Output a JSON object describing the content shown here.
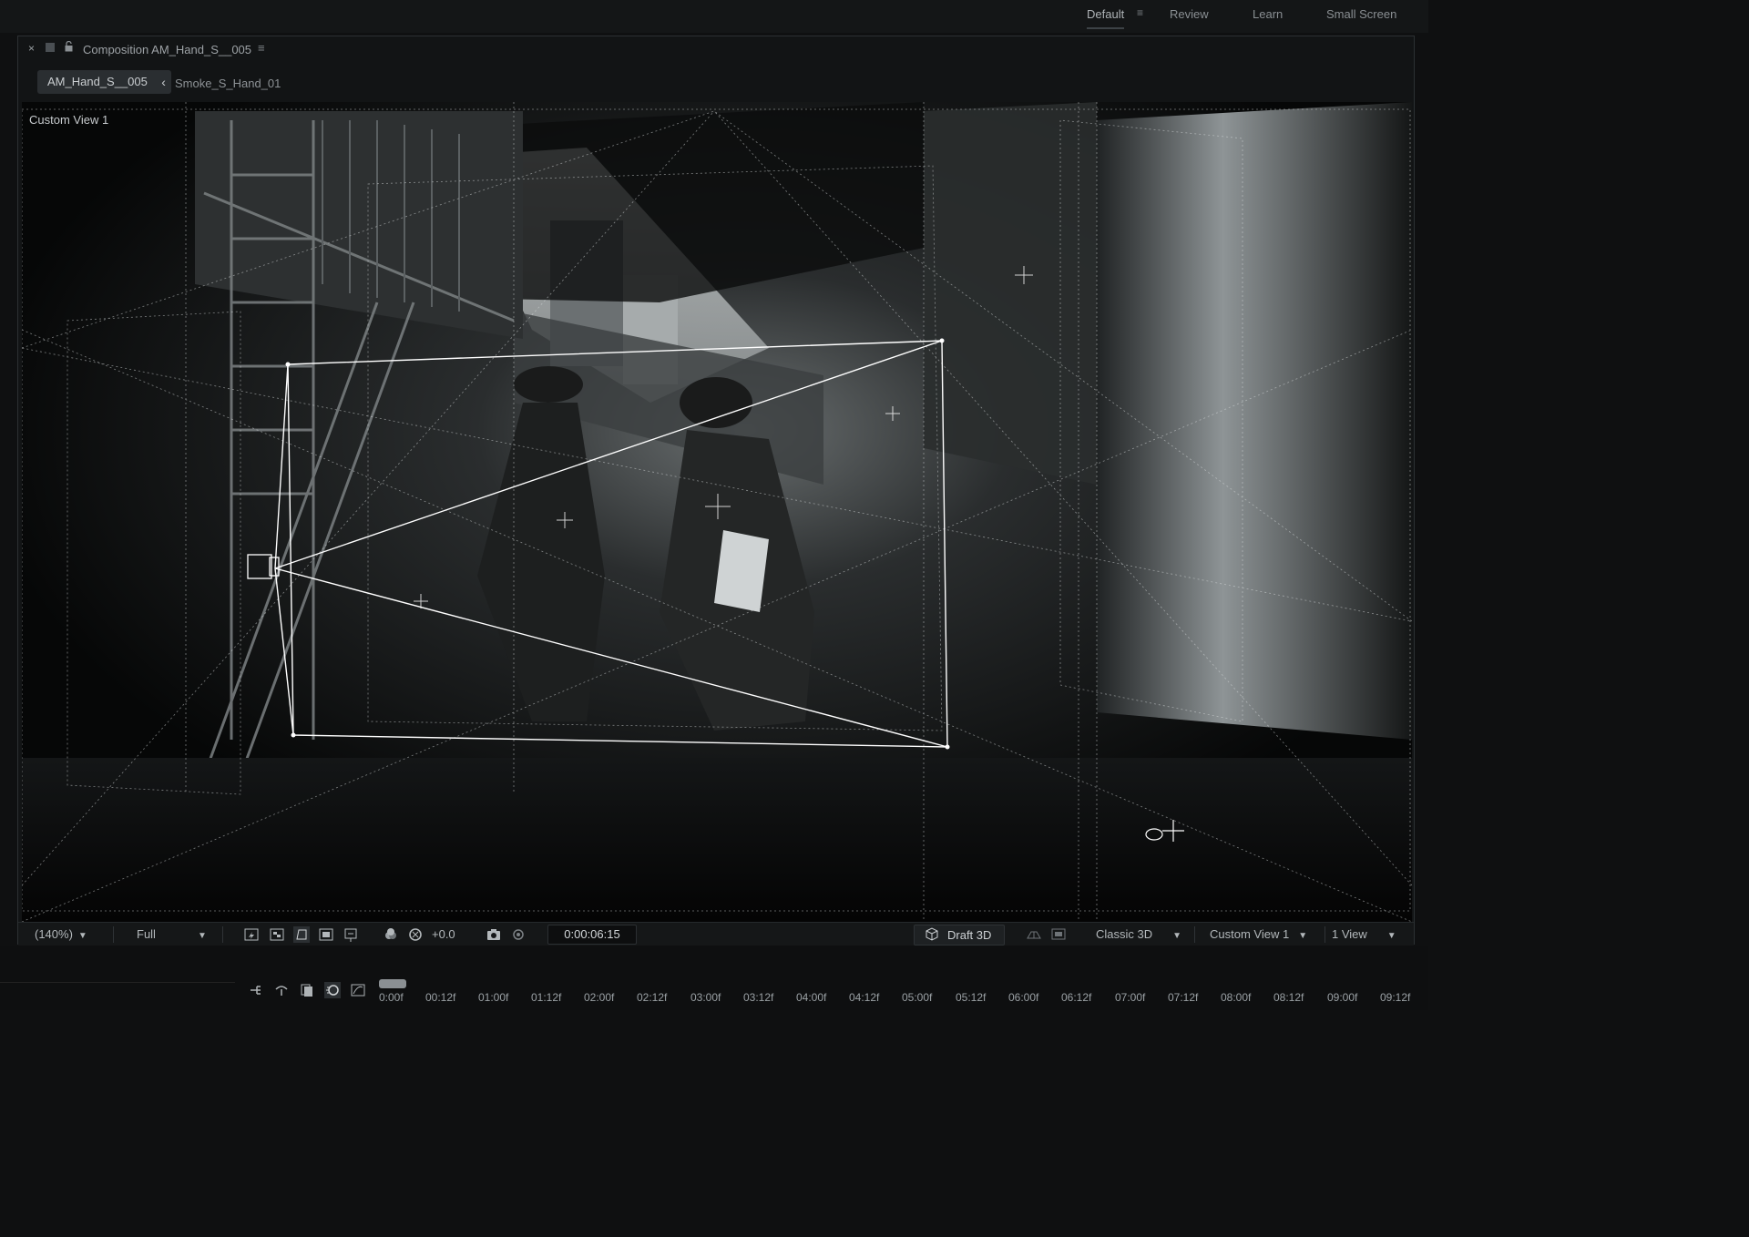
{
  "workspace": {
    "tabs": [
      {
        "label": "Default",
        "active": true
      },
      {
        "label": "Review",
        "active": false
      },
      {
        "label": "Learn",
        "active": false
      },
      {
        "label": "Small Screen",
        "active": false
      }
    ]
  },
  "panel": {
    "title": "Composition AM_Hand_S__005",
    "breadcrumbs": [
      "AM_Hand_S__005",
      "Smoke_S_Hand_01"
    ]
  },
  "viewer": {
    "view_label": "Custom View 1"
  },
  "toolbar": {
    "zoom": "(140%)",
    "resolution": "Full",
    "exposure": "+0.0",
    "timecode": "0:00:06:15",
    "draft_label": "Draft 3D",
    "renderer": "Classic 3D",
    "view": "Custom View 1",
    "layout": "1 View"
  },
  "timeline": {
    "ticks": [
      "0:00f",
      "00:12f",
      "01:00f",
      "01:12f",
      "02:00f",
      "02:12f",
      "03:00f",
      "03:12f",
      "04:00f",
      "04:12f",
      "05:00f",
      "05:12f",
      "06:00f",
      "06:12f",
      "07:00f",
      "07:12f",
      "08:00f",
      "08:12f",
      "09:00f",
      "09:12f"
    ]
  },
  "colors": {
    "background": "#0f1011",
    "panel": "#121415",
    "accent_line": "#ffffff"
  }
}
